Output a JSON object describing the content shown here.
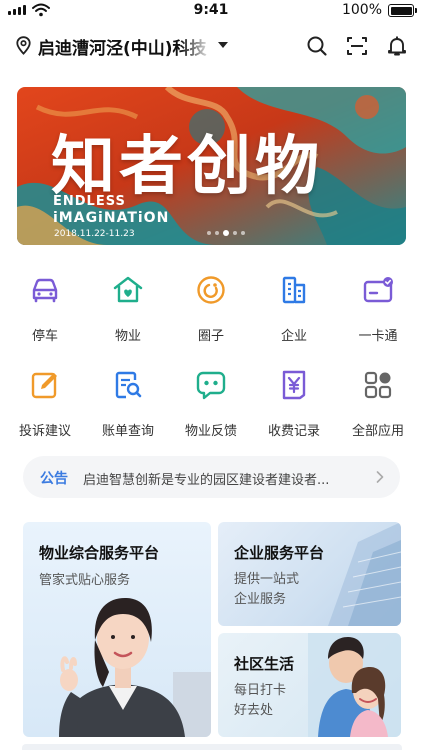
{
  "status_bar": {
    "time": "9:41",
    "battery": "100%"
  },
  "header": {
    "title": "启迪漕河泾(中山)科技",
    "icons": [
      "location-icon",
      "search-icon",
      "scan-icon",
      "bell-icon"
    ]
  },
  "banner": {
    "title": "知者创物",
    "subtitle_line1": "ENDLESS",
    "subtitle_line2": "iMAGiNATiON",
    "date": "2018.11.22-11.23",
    "pages": 5,
    "active_page": 3
  },
  "grid": {
    "row1": [
      {
        "label": "停车",
        "icon": "car-icon"
      },
      {
        "label": "物业",
        "icon": "house-heart-icon"
      },
      {
        "label": "圈子",
        "icon": "circle-icon"
      },
      {
        "label": "企业",
        "icon": "building-icon"
      },
      {
        "label": "一卡通",
        "icon": "card-icon"
      }
    ],
    "row2": [
      {
        "label": "投诉建议",
        "icon": "edit-icon"
      },
      {
        "label": "账单查询",
        "icon": "bill-search-icon"
      },
      {
        "label": "物业反馈",
        "icon": "chat-icon"
      },
      {
        "label": "收费记录",
        "icon": "yen-doc-icon"
      },
      {
        "label": "全部应用",
        "icon": "apps-icon"
      }
    ]
  },
  "notice": {
    "tag": "公告",
    "text": "启迪智慧创新是专业的园区建设者建设者..."
  },
  "cards": {
    "property": {
      "title": "物业综合服务平台",
      "subtitle": "管家式贴心服务"
    },
    "enterprise": {
      "title": "企业服务平台",
      "subtitle_line1": "提供一站式",
      "subtitle_line2": "企业服务"
    },
    "community": {
      "title": "社区生活",
      "subtitle_line1": "每日打卡",
      "subtitle_line2": "好去处"
    }
  },
  "colors": {
    "purple": "#7a5bd6",
    "teal": "#1fae8c",
    "orange": "#f09a2a",
    "blue": "#2f7ae5",
    "accent_blue": "#3b7be0",
    "gray": "#666666"
  }
}
